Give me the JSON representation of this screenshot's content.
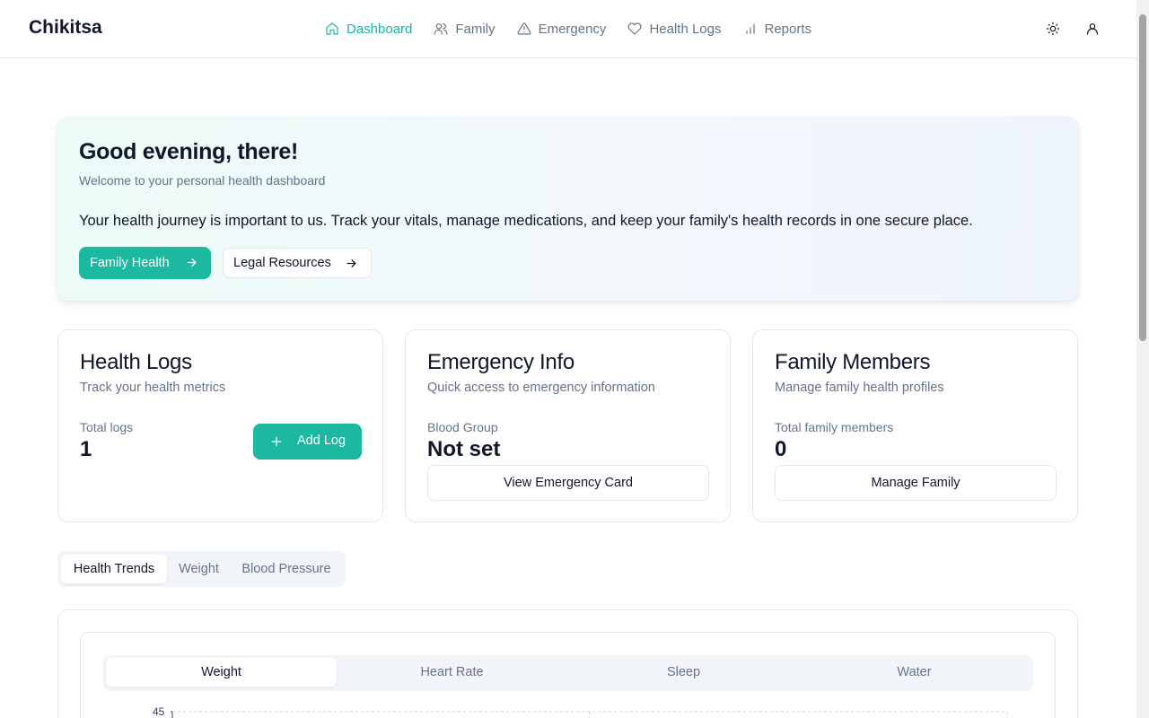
{
  "header": {
    "brand": "Chikitsa",
    "nav": [
      {
        "label": "Dashboard",
        "icon": "home-icon",
        "active": true
      },
      {
        "label": "Family",
        "icon": "users-icon",
        "active": false
      },
      {
        "label": "Emergency",
        "icon": "alert-triangle-icon",
        "active": false
      },
      {
        "label": "Health Logs",
        "icon": "heart-icon",
        "active": false
      },
      {
        "label": "Reports",
        "icon": "bar-chart-icon",
        "active": false
      }
    ],
    "actions": [
      "sun-icon",
      "user-icon"
    ]
  },
  "hero": {
    "title": "Good evening, there!",
    "subtitle": "Welcome to your personal health dashboard",
    "text": "Your health journey is important to us. Track your vitals, manage medications, and keep your family's health records in one secure place.",
    "primary_button": "Family Health",
    "secondary_button": "Legal Resources"
  },
  "cards": {
    "health_logs": {
      "title": "Health Logs",
      "subtitle": "Track your health metrics",
      "label": "Total logs",
      "value": "1",
      "button": "Add Log"
    },
    "emergency": {
      "title": "Emergency Info",
      "subtitle": "Quick access to emergency information",
      "label": "Blood Group",
      "value": "Not set",
      "button": "View Emergency Card"
    },
    "family": {
      "title": "Family Members",
      "subtitle": "Manage family health profiles",
      "label": "Total family members",
      "value": "0",
      "button": "Manage Family"
    }
  },
  "tabs": {
    "items": [
      "Health Trends",
      "Weight",
      "Blood Pressure"
    ],
    "active": "Health Trends"
  },
  "chart_panel": {
    "segments": [
      "Weight",
      "Heart Rate",
      "Sleep",
      "Water"
    ],
    "active": "Weight"
  },
  "chart_data": {
    "type": "line",
    "title": "",
    "xlabel": "",
    "ylabel": "",
    "y_ticks": [
      "45"
    ],
    "grid": true,
    "series": []
  },
  "colors": {
    "accent": "#1db8a0",
    "text": "#0f172a",
    "muted": "#64748b",
    "border": "#e5e7eb"
  }
}
